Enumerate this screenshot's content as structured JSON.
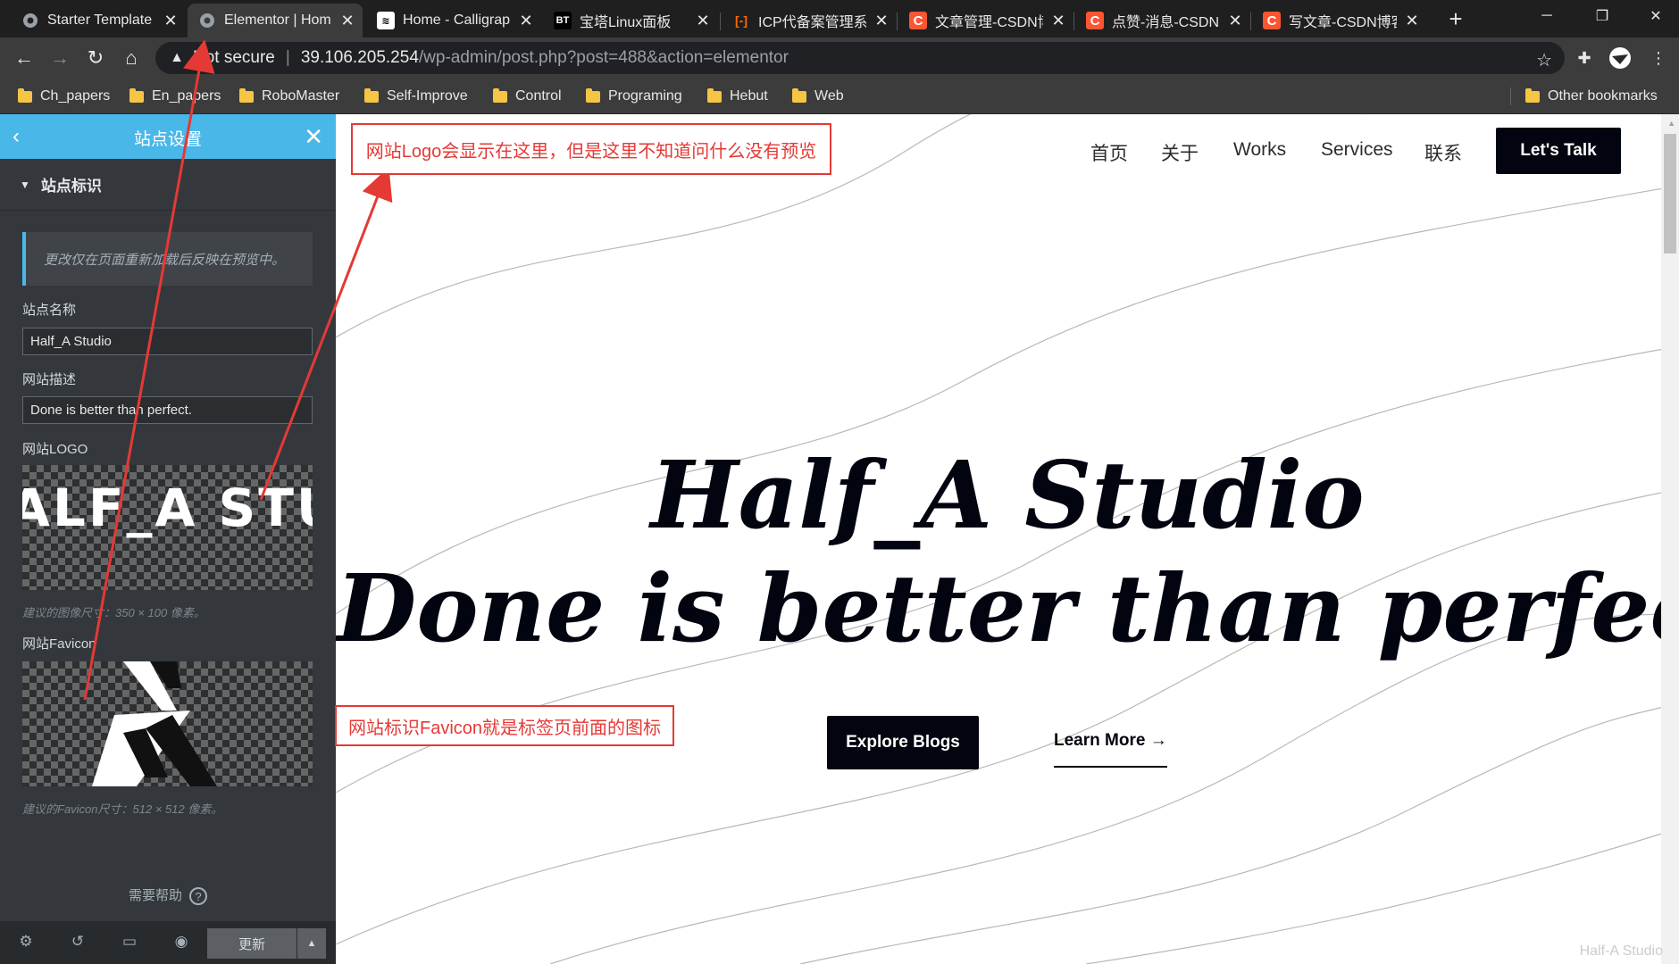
{
  "browser": {
    "tabs": [
      {
        "title": "Starter Template",
        "icon": "globe-icon",
        "fav_color": "#9aa0a6",
        "fav_text": ""
      },
      {
        "title": "Elementor | Hom",
        "icon": "globe-icon",
        "fav_color": "#9aa0a6",
        "fav_text": "",
        "active": true
      },
      {
        "title": "Home - Calligrap",
        "icon": "page-icon",
        "fav_color": "#ffffff",
        "fav_text": ""
      },
      {
        "title": "宝塔Linux面板",
        "icon": "bt-icon",
        "fav_color": "#000000",
        "fav_text": "BT"
      },
      {
        "title": "ICP代备案管理系",
        "icon": "aliyun-icon",
        "fav_color": "#ff6a00",
        "fav_text": "[-]"
      },
      {
        "title": "文章管理-CSDN博",
        "icon": "csdn-icon",
        "fav_color": "#fc5531",
        "fav_text": "C"
      },
      {
        "title": "点赞-消息-CSDN",
        "icon": "csdn-icon",
        "fav_color": "#fc5531",
        "fav_text": "C"
      },
      {
        "title": "写文章-CSDN博客",
        "icon": "csdn-icon",
        "fav_color": "#fc5531",
        "fav_text": "C"
      }
    ],
    "address": {
      "security": "Not secure",
      "host": "39.106.205.254",
      "path": "/wp-admin/post.php?post=488&action=elementor"
    },
    "bookmarks": [
      "Ch_papers",
      "En_papers",
      "RoboMaster",
      "Self-Improve",
      "Control",
      "Programing",
      "Hebut",
      "Web"
    ],
    "other_bookmarks": "Other bookmarks"
  },
  "panel": {
    "title": "站点设置",
    "section": "站点标识",
    "notice": "更改仅在页面重新加载后反映在预览中。",
    "site_name_label": "站点名称",
    "site_name_value": "Half_A Studio",
    "description_label": "网站描述",
    "description_value": "Done is better than perfect.",
    "logo_label": "网站LOGO",
    "logo_text": "ALF_A STUD",
    "logo_hint": "建议的图像尺寸：350 × 100 像素。",
    "favicon_label": "网站Favicon",
    "favicon_hint": "建议的Favicon尺寸：512 × 512 像素。",
    "help": "需要帮助",
    "update": "更新"
  },
  "preview": {
    "nav": [
      "首页",
      "关于",
      "Works",
      "Services",
      "联系"
    ],
    "cta": "Let's Talk",
    "hero_title": "Half_A Studio",
    "hero_subtitle": "Done is better than perfect",
    "explore": "Explore Blogs",
    "learn_more": "Learn More",
    "watermark": "Half-A Studio"
  },
  "annotations": {
    "logo_note": "网站Logo会显示在这里，但是这里不知道问什么没有预览",
    "favicon_note": "网站标识Favicon就是标签页前面的图标",
    "color": "#e53935"
  }
}
